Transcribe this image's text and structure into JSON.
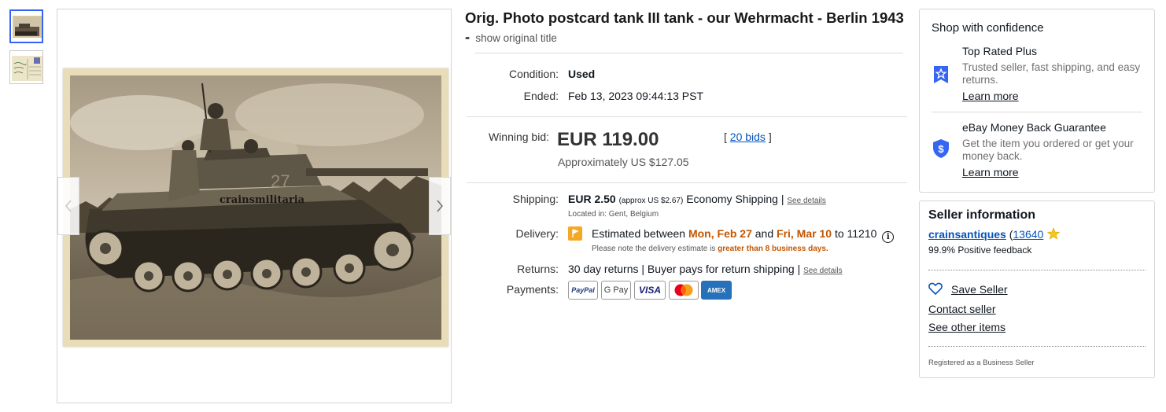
{
  "gallery": {
    "thumbnails": [
      "postcard-front",
      "postcard-back"
    ],
    "watermark": "crainsmilitaria",
    "prev_icon": "chevron-left-icon",
    "next_icon": "chevron-right-icon"
  },
  "listing": {
    "title": "Orig. Photo postcard tank III tank - our Wehrmacht - Berlin 1943 -",
    "show_original": "show original title",
    "condition_label": "Condition:",
    "condition_value": "Used",
    "ended_label": "Ended:",
    "ended_value": "Feb 13, 2023 09:44:13 PST"
  },
  "bid": {
    "label": "Winning bid:",
    "price": "EUR 119.00",
    "approx": "Approximately US $127.05",
    "bids_open": "[",
    "bids_link": "20 bids",
    "bids_close": "]"
  },
  "shipping": {
    "label": "Shipping:",
    "price": "EUR 2.50",
    "approx": "(approx US $2.67)",
    "method": "Economy Shipping",
    "sep": "|",
    "see_details": "See details",
    "location": "Located in: Gent, Belgium"
  },
  "delivery": {
    "label": "Delivery:",
    "text1": "Estimated between",
    "date1": "Mon, Feb 27",
    "and": "and",
    "date2": "Fri, Mar 10",
    "to": "to 11210",
    "note_pre": "Please note the delivery estimate is",
    "note_hl": "greater than 8 business days.",
    "flag_color": "#f7a823"
  },
  "returns": {
    "label": "Returns:",
    "text": "30 day returns | Buyer pays for return shipping",
    "sep": "|",
    "see_details": "See details"
  },
  "payments": {
    "label": "Payments:",
    "methods": [
      "PayPal",
      "G Pay",
      "VISA",
      "Mastercard",
      "AMEX"
    ]
  },
  "confidence": {
    "heading": "Shop with confidence",
    "items": [
      {
        "title": "Top Rated Plus",
        "desc": "Trusted seller, fast shipping, and easy returns.",
        "link": "Learn more",
        "icon": "top-rated-badge-icon"
      },
      {
        "title": "eBay Money Back Guarantee",
        "desc": "Get the item you ordered or get your money back.",
        "link": "Learn more",
        "icon": "shield-dollar-icon"
      }
    ]
  },
  "seller": {
    "heading": "Seller information",
    "name": "crainsantiques",
    "score_open": "(",
    "score": "13640",
    "feedback": "99.9% Positive feedback",
    "save": "Save Seller",
    "contact": "Contact seller",
    "other": "See other items",
    "registered": "Registered as a Business Seller"
  },
  "colors": {
    "link": "#0654ba",
    "accent_blue": "#3665f3",
    "highlight_orange": "#c45500"
  }
}
